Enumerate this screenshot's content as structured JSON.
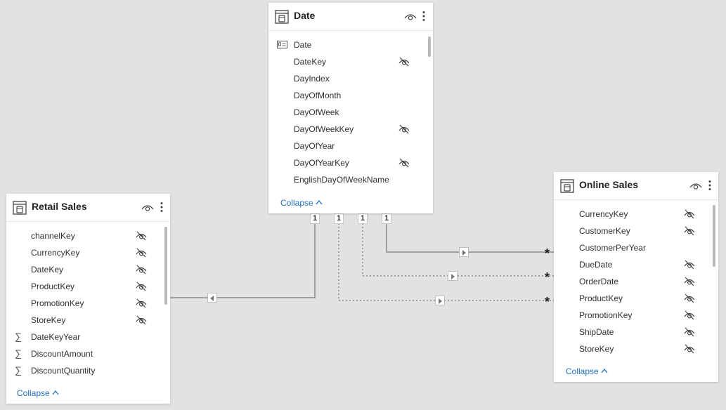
{
  "tables": {
    "date": {
      "title": "Date",
      "fields": [
        {
          "name": "Date",
          "kind": "date-hierarchy",
          "hidden": false
        },
        {
          "name": "DateKey",
          "kind": "field",
          "hidden": true
        },
        {
          "name": "DayIndex",
          "kind": "field",
          "hidden": false
        },
        {
          "name": "DayOfMonth",
          "kind": "field",
          "hidden": false
        },
        {
          "name": "DayOfWeek",
          "kind": "field",
          "hidden": false
        },
        {
          "name": "DayOfWeekKey",
          "kind": "field",
          "hidden": true
        },
        {
          "name": "DayOfYear",
          "kind": "field",
          "hidden": false
        },
        {
          "name": "DayOfYearKey",
          "kind": "field",
          "hidden": true
        },
        {
          "name": "EnglishDayOfWeekName",
          "kind": "field",
          "hidden": false
        }
      ],
      "collapse_label": "Collapse"
    },
    "retail_sales": {
      "title": "Retail Sales",
      "fields": [
        {
          "name": "channelKey",
          "kind": "field",
          "hidden": true
        },
        {
          "name": "CurrencyKey",
          "kind": "field",
          "hidden": true
        },
        {
          "name": "DateKey",
          "kind": "field",
          "hidden": true
        },
        {
          "name": "ProductKey",
          "kind": "field",
          "hidden": true
        },
        {
          "name": "PromotionKey",
          "kind": "field",
          "hidden": true
        },
        {
          "name": "StoreKey",
          "kind": "field",
          "hidden": true
        },
        {
          "name": "DateKeyYear",
          "kind": "sum",
          "hidden": false
        },
        {
          "name": "DiscountAmount",
          "kind": "sum",
          "hidden": false
        },
        {
          "name": "DiscountQuantity",
          "kind": "sum",
          "hidden": false
        }
      ],
      "collapse_label": "Collapse"
    },
    "online_sales": {
      "title": "Online Sales",
      "fields": [
        {
          "name": "CurrencyKey",
          "kind": "field",
          "hidden": true
        },
        {
          "name": "CustomerKey",
          "kind": "field",
          "hidden": true
        },
        {
          "name": "CustomerPerYear",
          "kind": "field",
          "hidden": false
        },
        {
          "name": "DueDate",
          "kind": "field",
          "hidden": true
        },
        {
          "name": "OrderDate",
          "kind": "field",
          "hidden": true
        },
        {
          "name": "ProductKey",
          "kind": "field",
          "hidden": true
        },
        {
          "name": "PromotionKey",
          "kind": "field",
          "hidden": true
        },
        {
          "name": "ShipDate",
          "kind": "field",
          "hidden": true
        },
        {
          "name": "StoreKey",
          "kind": "field",
          "hidden": true
        }
      ],
      "collapse_label": "Collapse"
    }
  },
  "relationships": [
    {
      "from_label": "1",
      "to_label": "",
      "to": "Retail Sales",
      "style": "solid"
    },
    {
      "from_label": "1",
      "to_label": "*",
      "to": "Online Sales",
      "style": "dotted"
    },
    {
      "from_label": "1",
      "to_label": "*",
      "to": "Online Sales",
      "style": "dotted"
    },
    {
      "from_label": "1",
      "to_label": "*",
      "to": "Online Sales",
      "style": "solid"
    }
  ],
  "colors": {
    "canvas": "#e3e2e1",
    "card": "#ffffff",
    "link": "#1f6fc2",
    "line": "#8a8a8a"
  }
}
